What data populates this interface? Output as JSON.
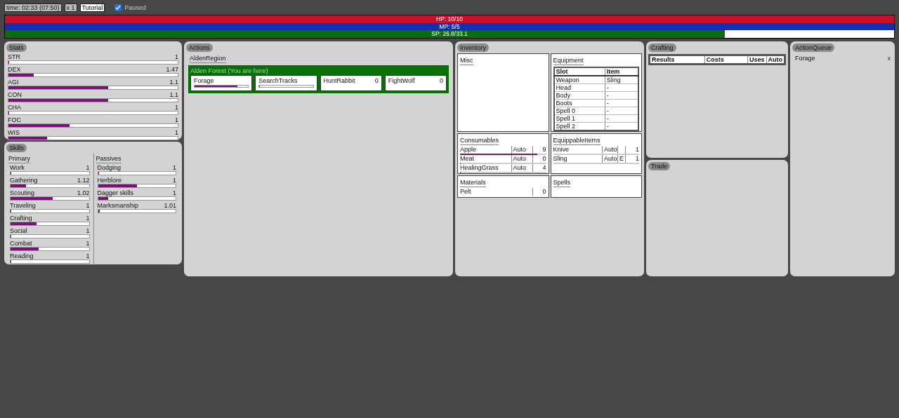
{
  "topbar": {
    "time": "time: 02:33 (07:50)",
    "speed": "x 1",
    "tutorial": "Tutorial",
    "paused": {
      "label": "Paused",
      "checked": true
    }
  },
  "bars": [
    {
      "label": "HP: 10/10",
      "level": 1,
      "color": "#c8102e"
    },
    {
      "label": "MP: 5/5",
      "level": 1,
      "color": "#1030b0"
    },
    {
      "label": "SP: 26.8/33.1",
      "level": 0.81,
      "color": "#0a6e0a"
    }
  ],
  "stats": {
    "title": "Stats",
    "items": [
      {
        "name": "STR",
        "value": "1",
        "level": 0
      },
      {
        "name": "DEX",
        "value": "1.47",
        "level": 0.15
      },
      {
        "name": "AGI",
        "value": "1.1",
        "level": 0.59
      },
      {
        "name": "CON",
        "value": "1.1",
        "level": 0.59
      },
      {
        "name": "CHA",
        "value": "1",
        "level": 0
      },
      {
        "name": "FOC",
        "value": "1",
        "level": 0.36
      },
      {
        "name": "WIS",
        "value": "1",
        "level": 0.23
      }
    ]
  },
  "skills": {
    "title": "Skills",
    "groups": [
      {
        "title": "Primary",
        "items": [
          {
            "name": "Work",
            "value": "1",
            "level": 0
          },
          {
            "name": "Gathering",
            "value": "1.12",
            "level": 0.2
          },
          {
            "name": "Scouting",
            "value": "1.02",
            "level": 0.54
          },
          {
            "name": "Traveling",
            "value": "1",
            "level": 0
          },
          {
            "name": "Crafting",
            "value": "1",
            "level": 0.33
          },
          {
            "name": "Social",
            "value": "1",
            "level": 0
          },
          {
            "name": "Combat",
            "value": "1",
            "level": 0.36
          },
          {
            "name": "Reading",
            "value": "1",
            "level": 0
          }
        ]
      },
      {
        "title": "Passives",
        "items": [
          {
            "name": "Dodging",
            "value": "1",
            "level": 0
          },
          {
            "name": "Herblore",
            "value": "1",
            "level": 0.5
          },
          {
            "name": "Dagger skills",
            "value": "1",
            "level": 0.13
          },
          {
            "name": "Marksmanship",
            "value": "1.01",
            "level": 0.02
          }
        ]
      }
    ]
  },
  "actions": {
    "title": "Actions",
    "region": "AldenRegion",
    "location": "Alden Forest (You are here)",
    "items": [
      {
        "kind": "progress",
        "name": "Forage",
        "level": 0.8
      },
      {
        "kind": "progress",
        "name": "SearchTracks",
        "level": 0
      },
      {
        "kind": "count",
        "name": "HuntRabbit",
        "count": "0"
      },
      {
        "kind": "count",
        "name": "FightWolf",
        "count": "0"
      }
    ]
  },
  "inventory": {
    "title": "Inventory",
    "misc": {
      "title": "Misc"
    },
    "equipment": {
      "title": "Equipment",
      "columns": [
        "Slot",
        "Item"
      ],
      "rows": [
        [
          "Weapon",
          "Sling"
        ],
        [
          "Head",
          "-"
        ],
        [
          "Body",
          "-"
        ],
        [
          "Boots",
          "-"
        ],
        [
          "Spell 0",
          "-"
        ],
        [
          "Spell 1",
          "-"
        ],
        [
          "Spell 2",
          "-"
        ]
      ]
    },
    "consumables": {
      "title": "Consumables",
      "items": [
        {
          "name": "Apple",
          "auto": "Auto",
          "count": "9",
          "level": 0.9
        },
        {
          "name": "Meat",
          "auto": "Auto",
          "count": "0",
          "level": 0
        },
        {
          "name": "HealingGrass",
          "auto": "Auto",
          "count": "4",
          "level": 0
        }
      ]
    },
    "equippable": {
      "title": "EquippableItems",
      "equipped_mark": "E",
      "items": [
        {
          "name": "Knive",
          "auto": "Auto",
          "equipped": false,
          "count": "1"
        },
        {
          "name": "Sling",
          "auto": "Auto",
          "equipped": true,
          "count": "1"
        }
      ]
    },
    "materials": {
      "title": "Materials",
      "items": [
        {
          "name": "Pelt",
          "count": "0"
        }
      ]
    },
    "spells": {
      "title": "Spells"
    }
  },
  "crafting": {
    "title": "Crafting",
    "columns": [
      "Results",
      "Costs",
      "Uses",
      "Auto"
    ]
  },
  "trade": {
    "title": "Trade"
  },
  "queue": {
    "title": "ActionQueue",
    "items": [
      {
        "name": "Forage",
        "remove": "x"
      }
    ]
  }
}
